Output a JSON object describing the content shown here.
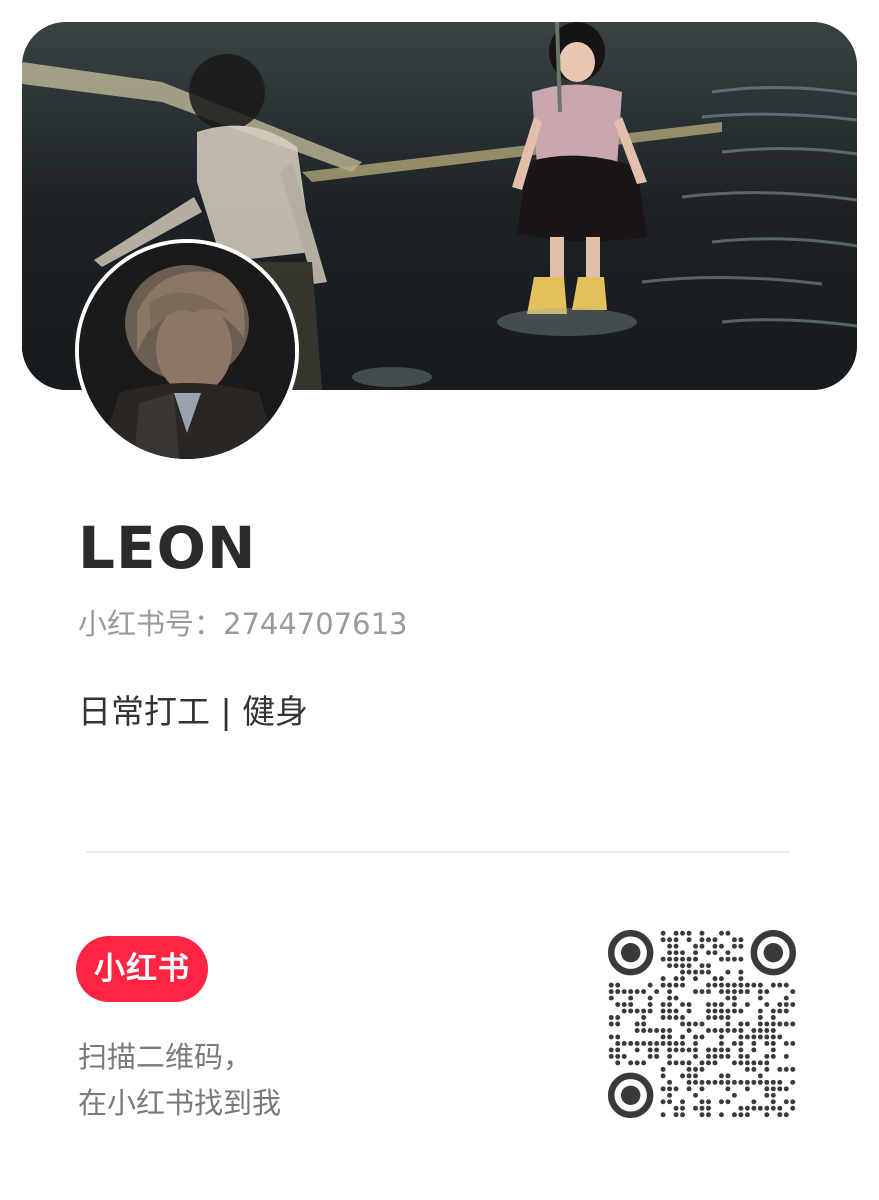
{
  "profile": {
    "name": "LEON",
    "account_id": "小红书号：2744707613",
    "bio": "日常打工 | 健身"
  },
  "footer": {
    "logo_text": "小红书",
    "scan_line_1": "扫描二维码，",
    "scan_line_2": "在小红书找到我"
  },
  "colors": {
    "brand": "#ff2442",
    "name_text": "#2b2b2b",
    "muted_text": "#9a9a9a"
  }
}
